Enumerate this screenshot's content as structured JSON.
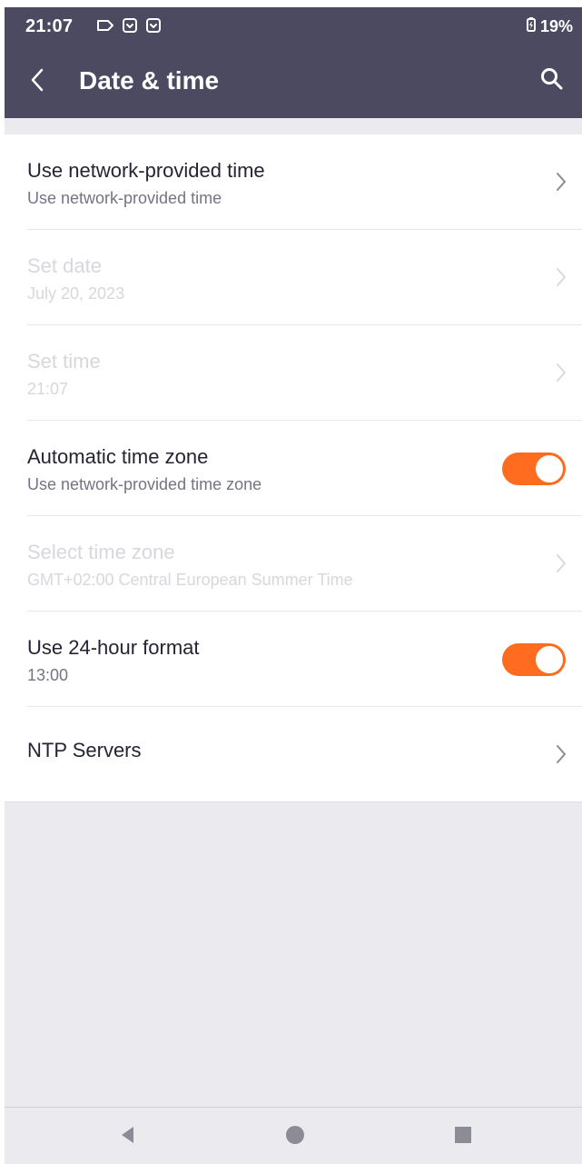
{
  "status_bar": {
    "time": "21:07",
    "battery": "19%",
    "icons": [
      "cast-outline-icon",
      "notification-box-icon",
      "notification-box-icon-2"
    ]
  },
  "header": {
    "title": "Date & time",
    "back_icon": "back-arrow-icon",
    "search_icon": "search-icon"
  },
  "colors": {
    "header": "#4b4a60",
    "accent": "#ff6b1f",
    "background": "#ebebef",
    "disabled_text": "#d7d7dd"
  },
  "settings": [
    {
      "title": "Use network-provided time",
      "subtitle": "Use network-provided time",
      "control": "chevron",
      "enabled": true
    },
    {
      "title": "Set date",
      "subtitle": "July 20, 2023",
      "control": "chevron",
      "enabled": false
    },
    {
      "title": "Set time",
      "subtitle": "21:07",
      "control": "chevron",
      "enabled": false
    },
    {
      "title": "Automatic time zone",
      "subtitle": "Use network-provided time zone",
      "control": "toggle",
      "enabled": true,
      "checked": true
    },
    {
      "title": "Select time zone",
      "subtitle": "GMT+02:00 Central European Summer Time",
      "control": "chevron",
      "enabled": false
    },
    {
      "title": "Use 24-hour format",
      "subtitle": "13:00",
      "control": "toggle",
      "enabled": true,
      "checked": true
    },
    {
      "title": "NTP Servers",
      "subtitle": "",
      "control": "chevron",
      "enabled": true
    }
  ],
  "navigation": {
    "back_icon": "nav-back-icon",
    "home_icon": "nav-home-icon",
    "recents_icon": "nav-recents-icon"
  }
}
